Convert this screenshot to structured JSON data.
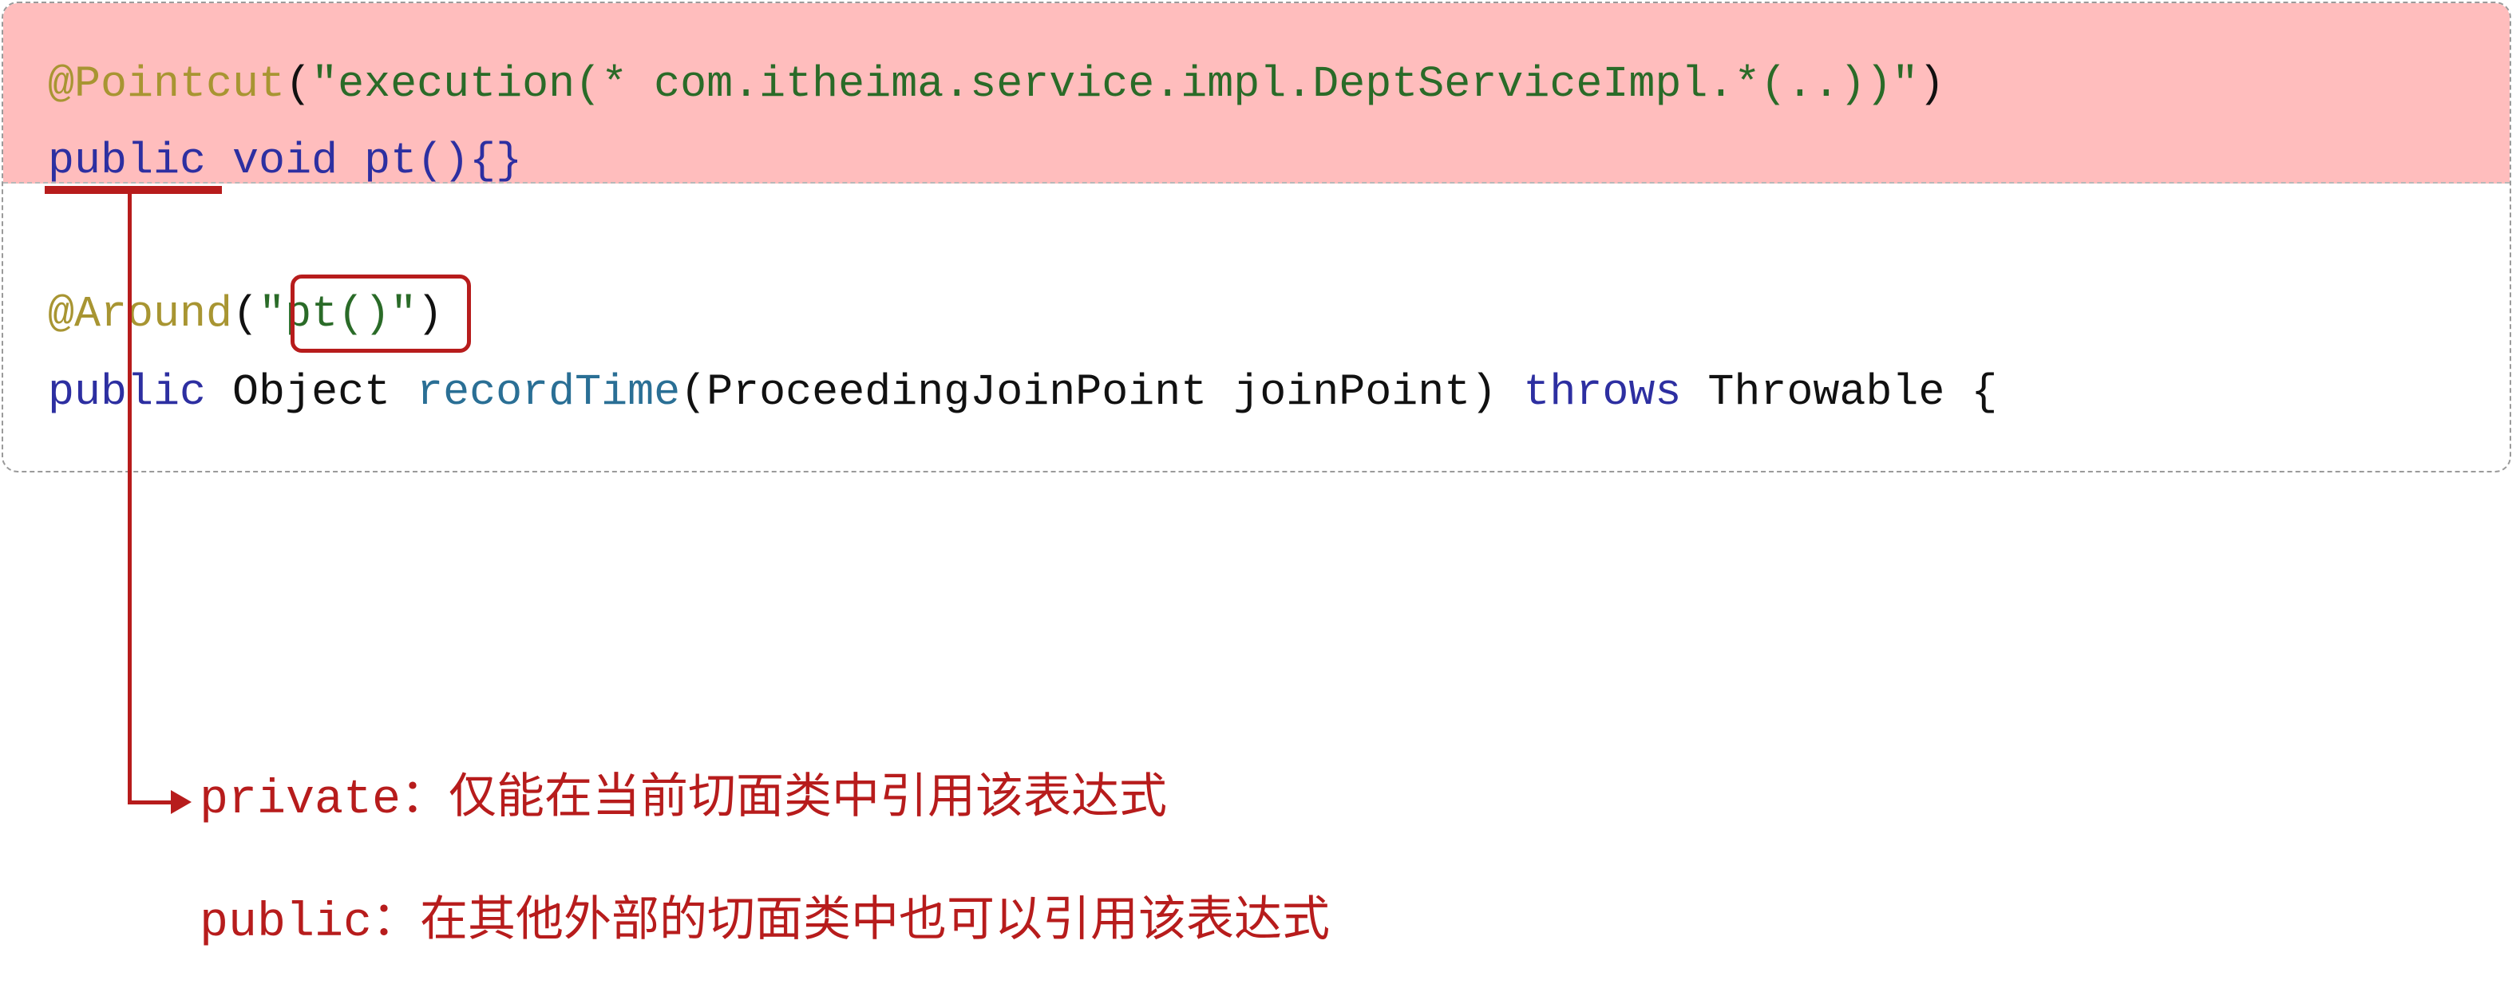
{
  "code": {
    "line1": {
      "annotation": "@Pointcut",
      "open": "(",
      "expression": "\"execution(* com.itheima.service.impl.DeptServiceImpl.*(..))\"",
      "close": ")"
    },
    "line2": {
      "modifier": "public",
      "rest": " void pt(){}"
    },
    "line3": {
      "annotation": "@Around",
      "open": "(",
      "reference": "\"pt()\"",
      "close": ")"
    },
    "line4": {
      "modifier": "public",
      "type": " Object ",
      "method": "recordTime",
      "params": "(ProceedingJoinPoint joinPoint) ",
      "throws_kw": "throws",
      "exception": " Throwable {"
    }
  },
  "notes": [
    {
      "keyword": "private",
      "text": "：仅能在当前切面类中引用该表达式"
    },
    {
      "keyword": "public",
      "text": "：在其他外部的切面类中也可以引用该表达式"
    }
  ],
  "colors": {
    "accent": "#b71c1c",
    "highlight": "#ffbdbd",
    "annotation": "#a89532",
    "string": "#2a6b28",
    "keyword": "#2d2fa1"
  }
}
